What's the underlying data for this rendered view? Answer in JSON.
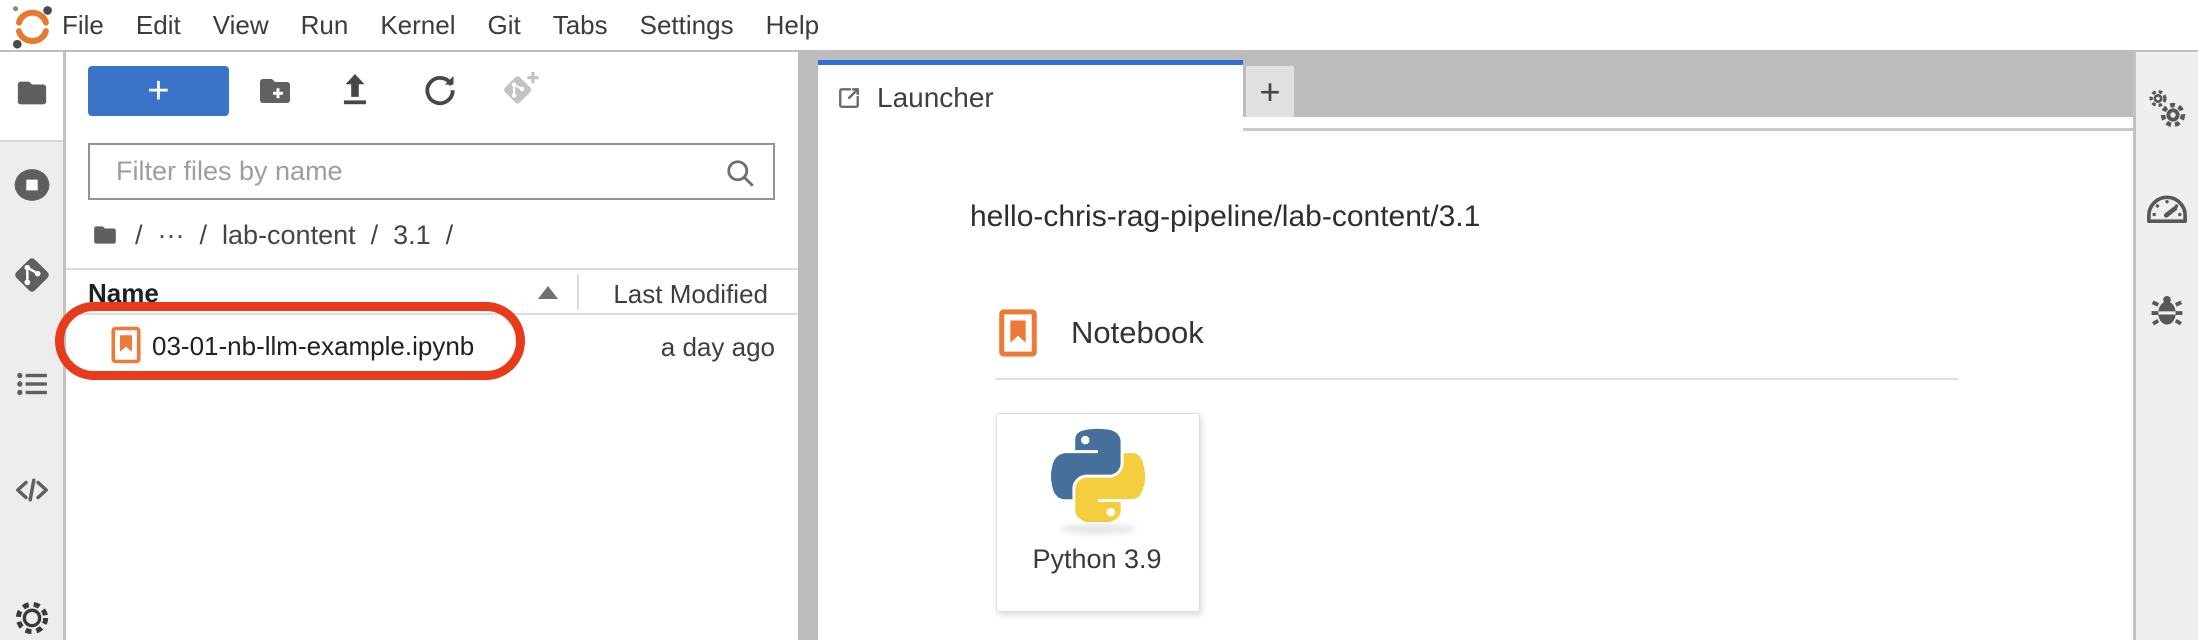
{
  "menubar": {
    "items": [
      "File",
      "Edit",
      "View",
      "Run",
      "Kernel",
      "Git",
      "Tabs",
      "Settings",
      "Help"
    ],
    "logo_icon": "orange-crescent-logo"
  },
  "left_sidebar": {
    "icons": [
      "file-browser-folder",
      "running-kernels-stop",
      "git-branch-diamond",
      "table-of-contents-list",
      "code-snippets",
      "settings-gear"
    ]
  },
  "file_browser": {
    "toolbar": {
      "new_launcher_label": "+",
      "icons": [
        "new-folder",
        "upload",
        "refresh",
        "git-clone-disabled"
      ]
    },
    "filter": {
      "placeholder": "Filter files by name",
      "icon": "search-icon"
    },
    "breadcrumb": {
      "parts": [
        "/",
        "···",
        "/",
        "lab-content",
        "/",
        "3.1",
        "/"
      ],
      "home_icon": "folder-icon"
    },
    "table": {
      "headers": {
        "name": "Name",
        "last_modified": "Last Modified"
      },
      "sort_icon": "sort-ascending-triangle",
      "rows": [
        {
          "icon": "notebook-icon",
          "name": "03-01-nb-llm-example.ipynb",
          "last_modified": "a day ago",
          "annotated": true
        }
      ]
    }
  },
  "main": {
    "tabs": [
      {
        "icon": "launcher-icon",
        "label": "Launcher",
        "active": true
      }
    ],
    "new_tab_label": "+",
    "launcher": {
      "cwd": "hello-chris-rag-pipeline/lab-content/3.1",
      "sections": [
        {
          "icon": "notebook-icon",
          "title": "Notebook",
          "cards": [
            {
              "icon": "python-logo",
              "label": "Python 3.9"
            }
          ]
        }
      ]
    }
  },
  "right_sidebar": {
    "icons": [
      "property-inspector-gears",
      "resource-usage-gauge",
      "debugger-bug"
    ]
  },
  "colors": {
    "accent_blue": "#3b73c9",
    "tab_accent_blue": "#2b6fd4",
    "annotation_red": "#e73b1c",
    "notebook_orange": "#ee7a38",
    "python_blue": "#466f9c",
    "python_yellow": "#f3cf3f",
    "logo_orange": "#e87a30",
    "tabbar_gray": "#bcbcbc",
    "rail_gray": "#ededed"
  }
}
